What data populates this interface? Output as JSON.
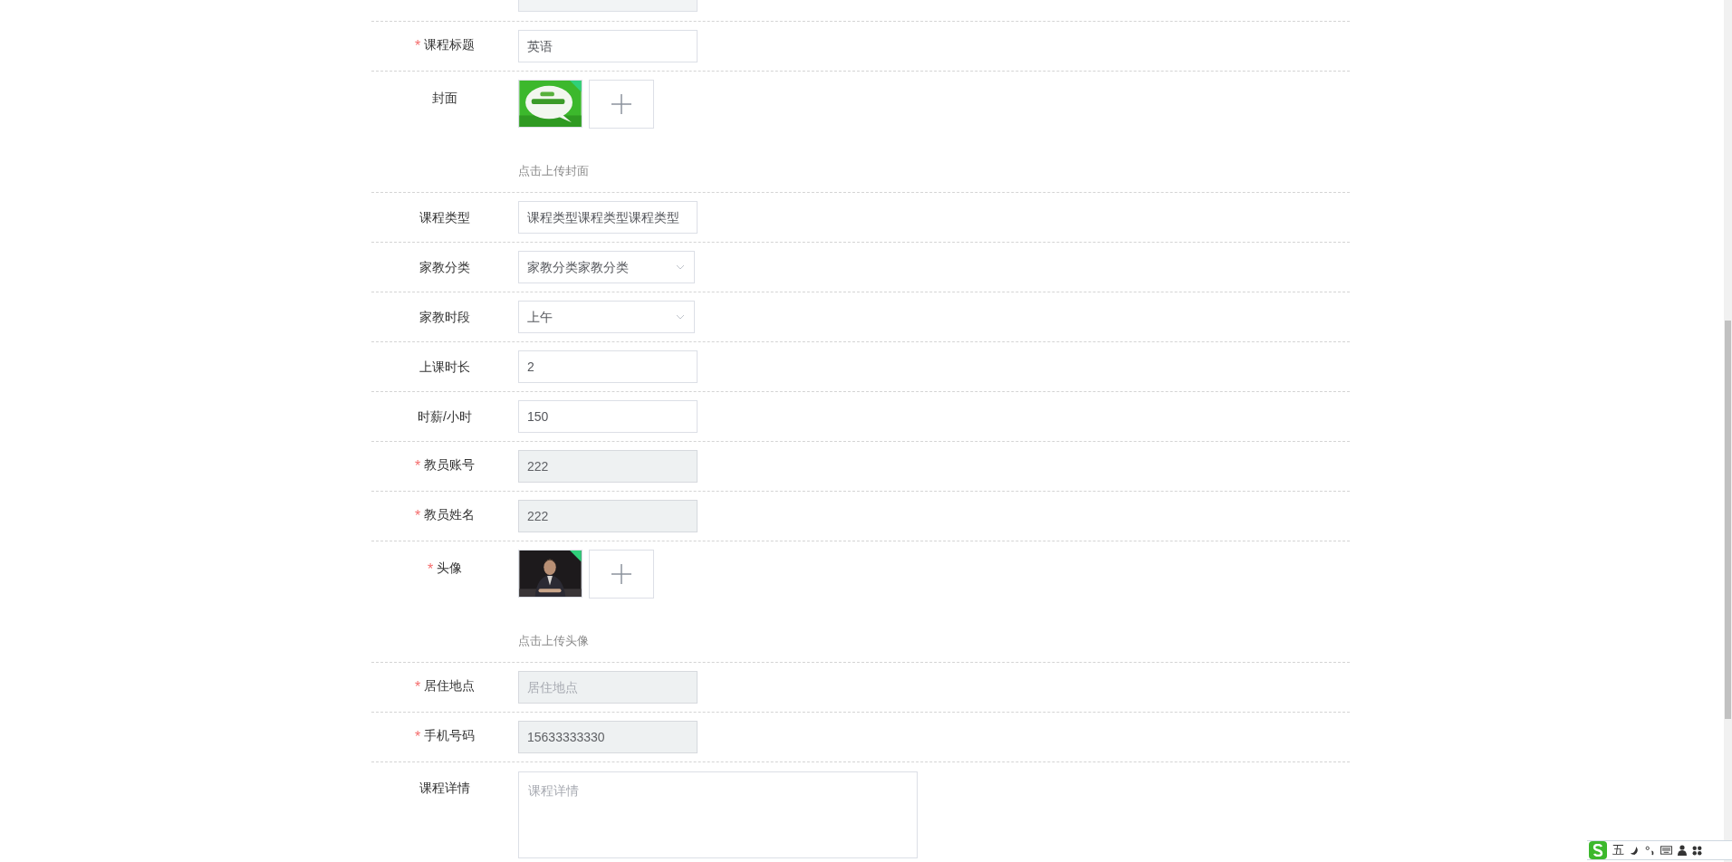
{
  "form": {
    "rows": [
      {
        "kind": "partial"
      },
      {
        "kind": "text",
        "label": "课程标题",
        "required_mark": "*",
        "value": "英语",
        "disabled": false
      },
      {
        "kind": "upload",
        "label": "封面",
        "uploaded": true,
        "hint": "点击上传封面"
      },
      {
        "kind": "text",
        "label": "课程类型",
        "value": "课程类型课程类型课程类型",
        "disabled": false
      },
      {
        "kind": "select",
        "label": "家教分类",
        "value": "家教分类家教分类"
      },
      {
        "kind": "select",
        "label": "家教时段",
        "value": "上午"
      },
      {
        "kind": "text",
        "label": "上课时长",
        "value": "2",
        "disabled": false
      },
      {
        "kind": "text",
        "label": "时薪/小时",
        "value": "150",
        "disabled": false
      },
      {
        "kind": "text",
        "label": "教员账号",
        "required_mark": "*",
        "value": "222",
        "disabled": true
      },
      {
        "kind": "text",
        "label": "教员姓名",
        "required_mark": "*",
        "value": "222",
        "disabled": true
      },
      {
        "kind": "upload",
        "label": "头像",
        "required_mark": "*",
        "uploaded": true,
        "hint": "点击上传头像"
      },
      {
        "kind": "text",
        "label": "居住地点",
        "required_mark": "*",
        "placeholder": "居住地点",
        "disabled": true
      },
      {
        "kind": "text",
        "label": "手机号码",
        "required_mark": "*",
        "value": "15633333330",
        "disabled": true
      },
      {
        "kind": "textarea",
        "label": "课程详情",
        "placeholder": "课程详情"
      }
    ]
  },
  "ime_toolbar": {
    "mode": "五"
  }
}
